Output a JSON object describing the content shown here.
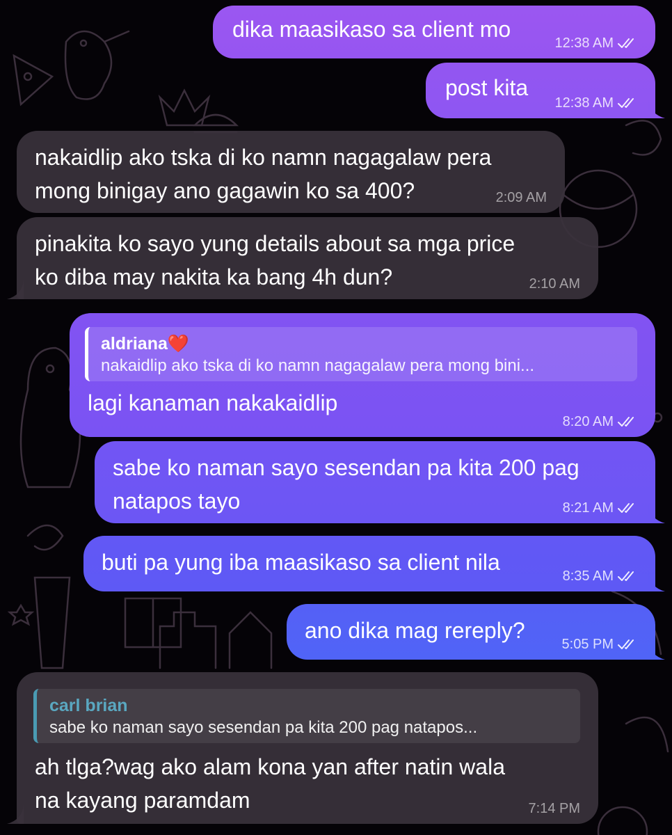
{
  "chat": {
    "messages": [
      {
        "text": "dika maasikaso sa client mo",
        "time": "12:38 AM"
      },
      {
        "text": "post kita",
        "time": "12:38 AM"
      },
      {
        "lines": [
          "nakaidlip ako tska di ko namn nagagalaw pera",
          "mong binigay ano gagawin ko sa 400?"
        ],
        "time": "2:09 AM"
      },
      {
        "lines": [
          "pinakita ko sayo yung details about sa mga price",
          "ko diba may nakita ka bang 4h dun?"
        ],
        "time": "2:10 AM"
      },
      {
        "reply_name": "aldriana❤️",
        "reply_text": "nakaidlip ako tska di ko namn nagagalaw pera mong bini...",
        "text": "lagi kanaman nakakaidlip",
        "time": "8:20 AM"
      },
      {
        "lines": [
          "sabe ko naman sayo sesendan pa kita 200 pag",
          "natapos tayo"
        ],
        "time": "8:21 AM"
      },
      {
        "text": "buti pa yung iba maasikaso sa client nila",
        "time": "8:35 AM"
      },
      {
        "text": "ano dika mag rereply?",
        "time": "5:05 PM"
      },
      {
        "reply_name": "carl brian",
        "reply_text": "sabe ko naman sayo sesendan pa kita 200 pag natapos...",
        "lines": [
          "ah tlga?wag ako alam kona yan after natin wala",
          "na kayang paramdam"
        ],
        "time": "7:14 PM"
      }
    ]
  },
  "colors": {
    "outgoing_gradient_top": "#9b57f1",
    "outgoing_gradient_bottom": "#4f66f7",
    "incoming": "#3a323c",
    "background": "#050307",
    "reply_accent_incoming": "#4a9bb3"
  },
  "icons": {
    "read_receipt": "double-check-icon"
  }
}
